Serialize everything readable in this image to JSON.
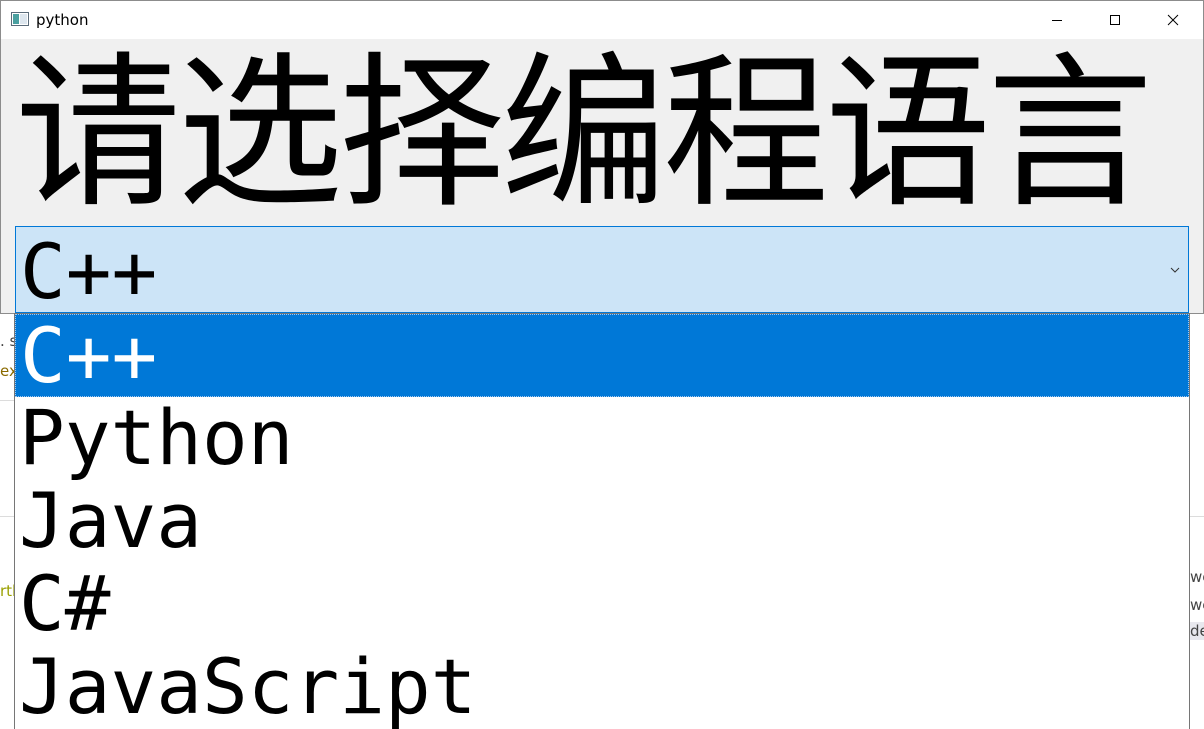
{
  "window": {
    "title": "python"
  },
  "heading": {
    "text": "请选择编程语言"
  },
  "combo": {
    "selected_value": "C++",
    "options": [
      "C++",
      "Python",
      "Java",
      "C#",
      "JavaScript"
    ],
    "selected_index": 0
  },
  "background_fragments": {
    "left_1": ". s",
    "left_2": "ex",
    "left_3": "rtl",
    "right_1": "we",
    "right_2": "we",
    "right_3": "de"
  },
  "colors": {
    "accent": "#0078d7",
    "combo_bg": "#cce4f7",
    "window_bg": "#f0f0f0"
  }
}
